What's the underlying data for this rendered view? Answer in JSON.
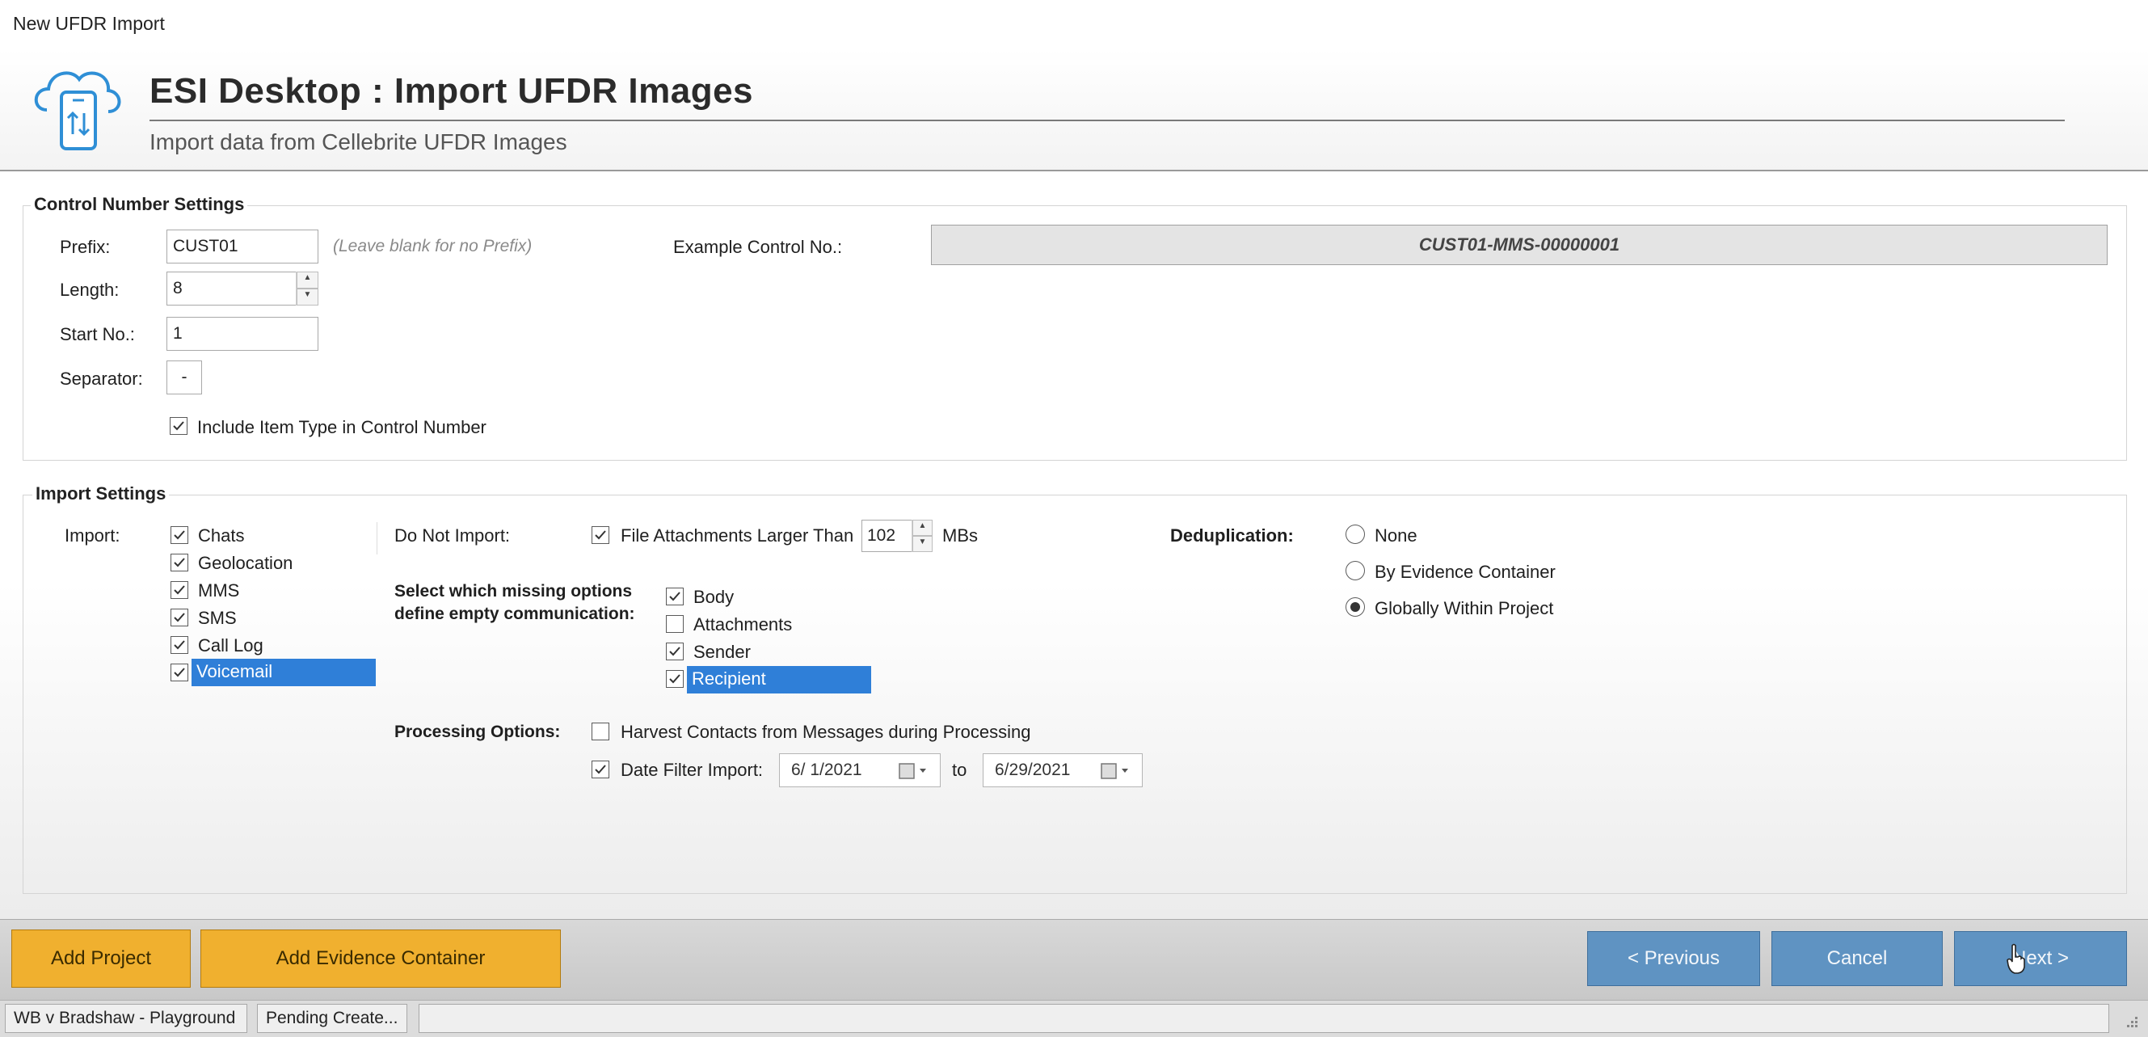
{
  "window": {
    "title": "New UFDR Import"
  },
  "header": {
    "title": "ESI Desktop : Import UFDR Images",
    "subtitle": "Import data from Cellebrite UFDR Images",
    "logo_icon": "cloud-phone-icon"
  },
  "control_settings": {
    "title": "Control Number Settings",
    "prefix_label": "Prefix:",
    "prefix_value": "CUST01",
    "prefix_hint": "(Leave blank for no Prefix)",
    "length_label": "Length:",
    "length_value": "8",
    "start_label": "Start No.:",
    "start_value": "1",
    "separator_label": "Separator:",
    "separator_value": "-",
    "include_type_label": "Include Item Type in Control Number",
    "include_type_checked": true,
    "example_label": "Example Control No.:",
    "example_value": "CUST01-MMS-00000001"
  },
  "import_settings": {
    "title": "Import Settings",
    "import_label": "Import:",
    "import_items": [
      {
        "label": "Chats",
        "checked": true
      },
      {
        "label": "Geolocation",
        "checked": true
      },
      {
        "label": "MMS",
        "checked": true
      },
      {
        "label": "SMS",
        "checked": true
      },
      {
        "label": "Call Log",
        "checked": true
      },
      {
        "label": "Voicemail",
        "checked": true
      }
    ],
    "do_not_import_label": "Do Not Import:",
    "file_attach_label": "File Attachments Larger Than",
    "file_attach_checked": true,
    "file_attach_value": "102",
    "file_attach_unit": "MBs",
    "empty_comm_label_line1": "Select which missing options",
    "empty_comm_label_line2": "define empty communication:",
    "empty_items": [
      {
        "label": "Body",
        "checked": true
      },
      {
        "label": "Attachments",
        "checked": false
      },
      {
        "label": "Sender",
        "checked": true
      },
      {
        "label": "Recipient",
        "checked": true
      }
    ],
    "processing_label": "Processing Options:",
    "harvest_label": "Harvest Contacts from Messages during Processing",
    "harvest_checked": false,
    "date_filter_label": "Date Filter Import:",
    "date_filter_checked": true,
    "date_from": "6/ 1/2021",
    "date_to_label": "to",
    "date_to": "6/29/2021",
    "dedup_label": "Deduplication:",
    "dedup_options": [
      {
        "label": "None",
        "selected": false
      },
      {
        "label": "By Evidence Container",
        "selected": false
      },
      {
        "label": "Globally Within Project",
        "selected": true
      }
    ]
  },
  "footer": {
    "add_project": "Add Project",
    "add_evidence": "Add Evidence Container",
    "previous": "< Previous",
    "cancel": "Cancel",
    "next": "Next >"
  },
  "statusbar": {
    "project": "WB v Bradshaw - Playground",
    "pending": "Pending Create..."
  },
  "colors": {
    "accent_blue": "#5f93c2",
    "accent_orange": "#f0b02f",
    "selection": "#2f7fd8"
  }
}
